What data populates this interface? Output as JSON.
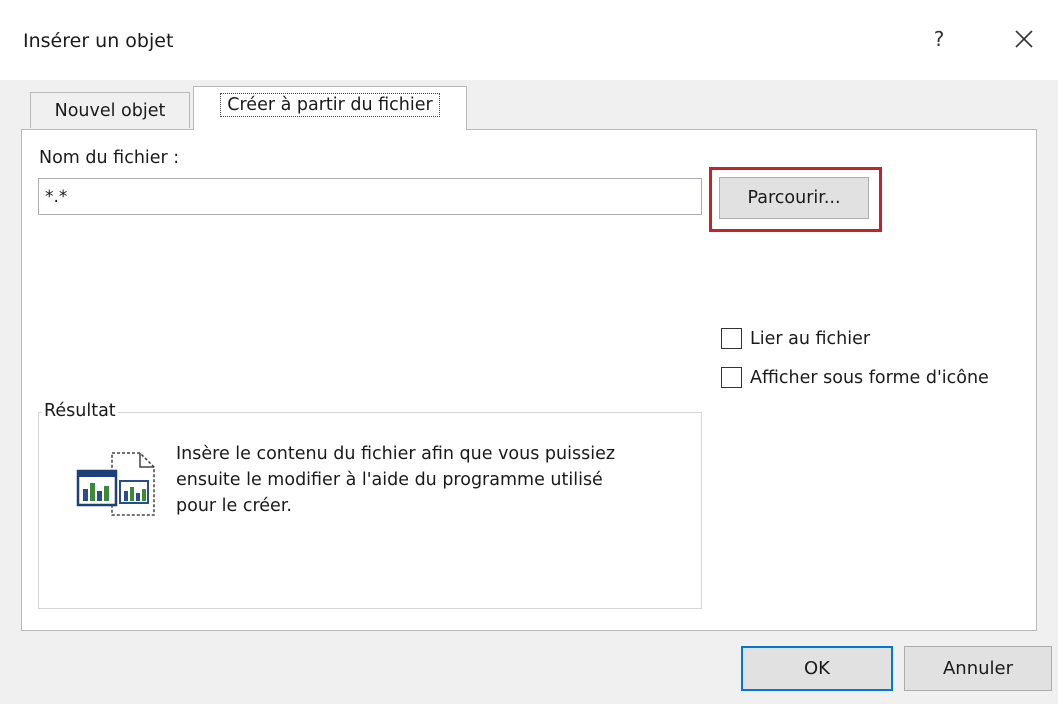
{
  "window": {
    "title": "Insérer un objet",
    "help_label": "?",
    "close_icon": "close-icon"
  },
  "tabs": [
    {
      "label": "Nouvel objet",
      "selected": false
    },
    {
      "label": "Créer à partir du fichier",
      "selected": true
    }
  ],
  "file": {
    "label": "Nom du fichier :",
    "value": "*.*",
    "browse_label": "Parcourir..."
  },
  "options": {
    "link_label": "Lier au fichier",
    "link_checked": false,
    "icon_label": "Afficher sous forme d'icône",
    "icon_checked": false
  },
  "result": {
    "legend": "Résultat",
    "description": "Insère le contenu du fichier afin que vous puissiez ensuite le modifier à l'aide du programme utilisé pour le créer.",
    "icon": "embedded-document-icon"
  },
  "buttons": {
    "ok_label": "OK",
    "cancel_label": "Annuler"
  },
  "colors": {
    "highlight": "#c8202c",
    "default_button_border": "#0078d7"
  }
}
